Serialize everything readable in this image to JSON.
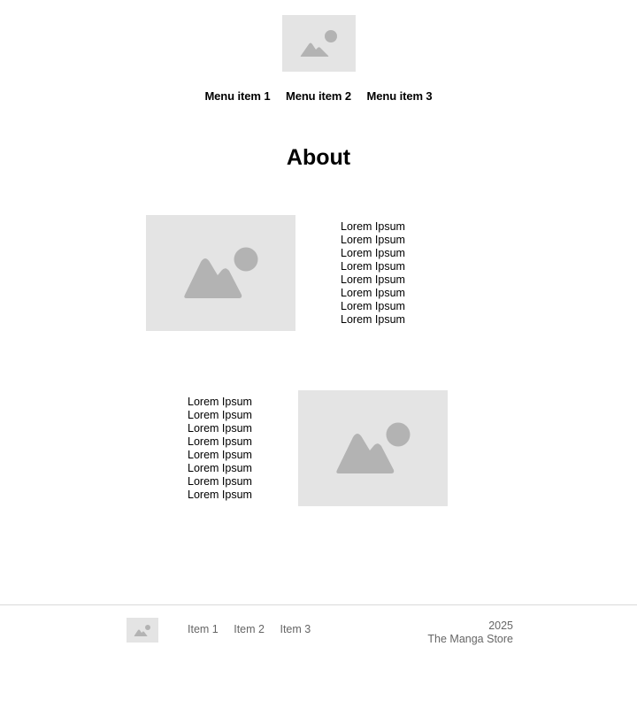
{
  "header": {
    "logo_icon": "image-placeholder-icon",
    "menu": [
      "Menu item 1",
      "Menu item 2",
      "Menu item 3"
    ]
  },
  "main": {
    "title": "About",
    "section1": {
      "image_icon": "image-placeholder-icon",
      "lines": [
        "Lorem Ipsum",
        "Lorem Ipsum",
        "Lorem Ipsum",
        "Lorem Ipsum",
        "Lorem Ipsum",
        "Lorem Ipsum",
        "Lorem Ipsum",
        "Lorem Ipsum"
      ]
    },
    "section2": {
      "image_icon": "image-placeholder-icon",
      "lines": [
        "Lorem Ipsum",
        "Lorem Ipsum",
        "Lorem Ipsum",
        "Lorem Ipsum",
        "Lorem Ipsum",
        "Lorem Ipsum",
        "Lorem Ipsum",
        "Lorem Ipsum"
      ]
    }
  },
  "footer": {
    "logo_icon": "image-placeholder-icon",
    "items": [
      "Item 1",
      "Item 2",
      "Item 3"
    ],
    "year": "2025",
    "company": "The Manga Store"
  },
  "colors": {
    "placeholder_bg": "#e4e4e4",
    "placeholder_fg": "#b3b3b3",
    "footer_text": "#666666",
    "divider": "#d9d9d9"
  }
}
